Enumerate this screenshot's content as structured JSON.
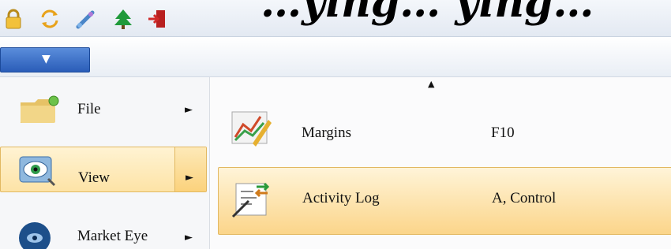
{
  "window": {
    "title": "…ying… ying…"
  },
  "toolbar": {
    "icons": [
      "lock-icon",
      "refresh-icon",
      "connect-icon",
      "tree-icon",
      "exit-icon"
    ]
  },
  "menu_button": {
    "icon": "chevron-down-icon"
  },
  "left_menu": {
    "items": [
      {
        "label": "File",
        "icon": "folder-icon",
        "has_submenu": true
      },
      {
        "label": "View",
        "icon": "eye-icon",
        "has_submenu": true,
        "active": true
      },
      {
        "label": "Market Eye",
        "icon": "globe-eye-icon",
        "has_submenu": true
      }
    ]
  },
  "submenu": {
    "items": [
      {
        "label": "Margins",
        "shortcut": "F10",
        "icon": "chart-icon"
      },
      {
        "label": "Activity Log",
        "shortcut": "A, Control",
        "icon": "log-icon",
        "highlighted": true
      }
    ]
  },
  "colors": {
    "accent": "#2a5db8",
    "highlight": "#fbd58a",
    "highlight_border": "#e2b861"
  }
}
